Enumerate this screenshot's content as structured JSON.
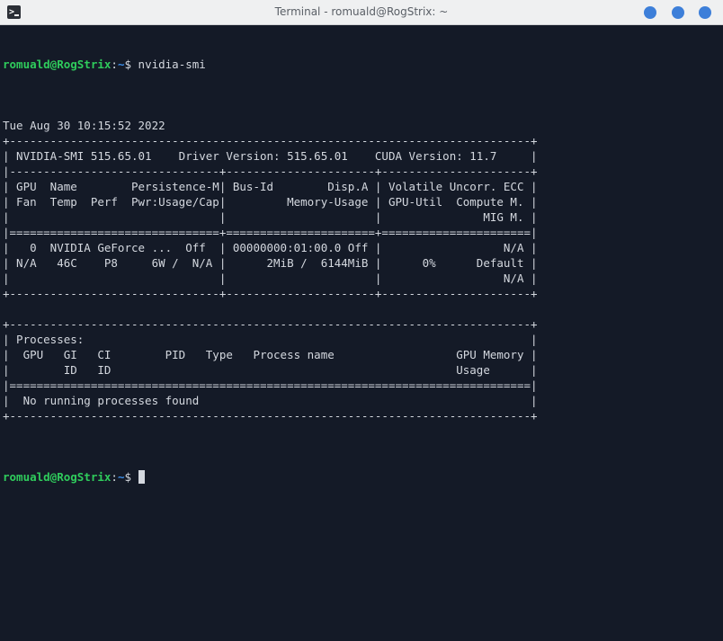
{
  "window": {
    "title": "Terminal - romuald@RogStrix: ~",
    "app_icon_glyph": ">_",
    "buttons": [
      "minimize",
      "maximize",
      "close"
    ],
    "button_color": "#3d7fd9"
  },
  "terminal": {
    "prompt": {
      "user_host": "romuald@RogStrix",
      "separator": ":",
      "path": "~",
      "symbol": "$ "
    },
    "command": "nvidia-smi",
    "output_lines": [
      "Tue Aug 30 10:15:52 2022",
      "+-----------------------------------------------------------------------------+",
      "| NVIDIA-SMI 515.65.01    Driver Version: 515.65.01    CUDA Version: 11.7     |",
      "|-------------------------------+----------------------+----------------------+",
      "| GPU  Name        Persistence-M| Bus-Id        Disp.A | Volatile Uncorr. ECC |",
      "| Fan  Temp  Perf  Pwr:Usage/Cap|         Memory-Usage | GPU-Util  Compute M. |",
      "|                               |                      |               MIG M. |",
      "|===============================+======================+======================|",
      "|   0  NVIDIA GeForce ...  Off  | 00000000:01:00.0 Off |                  N/A |",
      "| N/A   46C    P8     6W /  N/A |      2MiB /  6144MiB |      0%      Default |",
      "|                               |                      |                  N/A |",
      "+-------------------------------+----------------------+----------------------+",
      "",
      "+-----------------------------------------------------------------------------+",
      "| Processes:                                                                  |",
      "|  GPU   GI   CI        PID   Type   Process name                  GPU Memory |",
      "|        ID   ID                                                   Usage      |",
      "|=============================================================================|",
      "|  No running processes found                                                 |",
      "+-----------------------------------------------------------------------------+"
    ],
    "colors": {
      "background": "#141a27",
      "foreground": "#d4d8df",
      "prompt_user": "#2fcc5c",
      "prompt_path": "#3b8eea"
    }
  }
}
